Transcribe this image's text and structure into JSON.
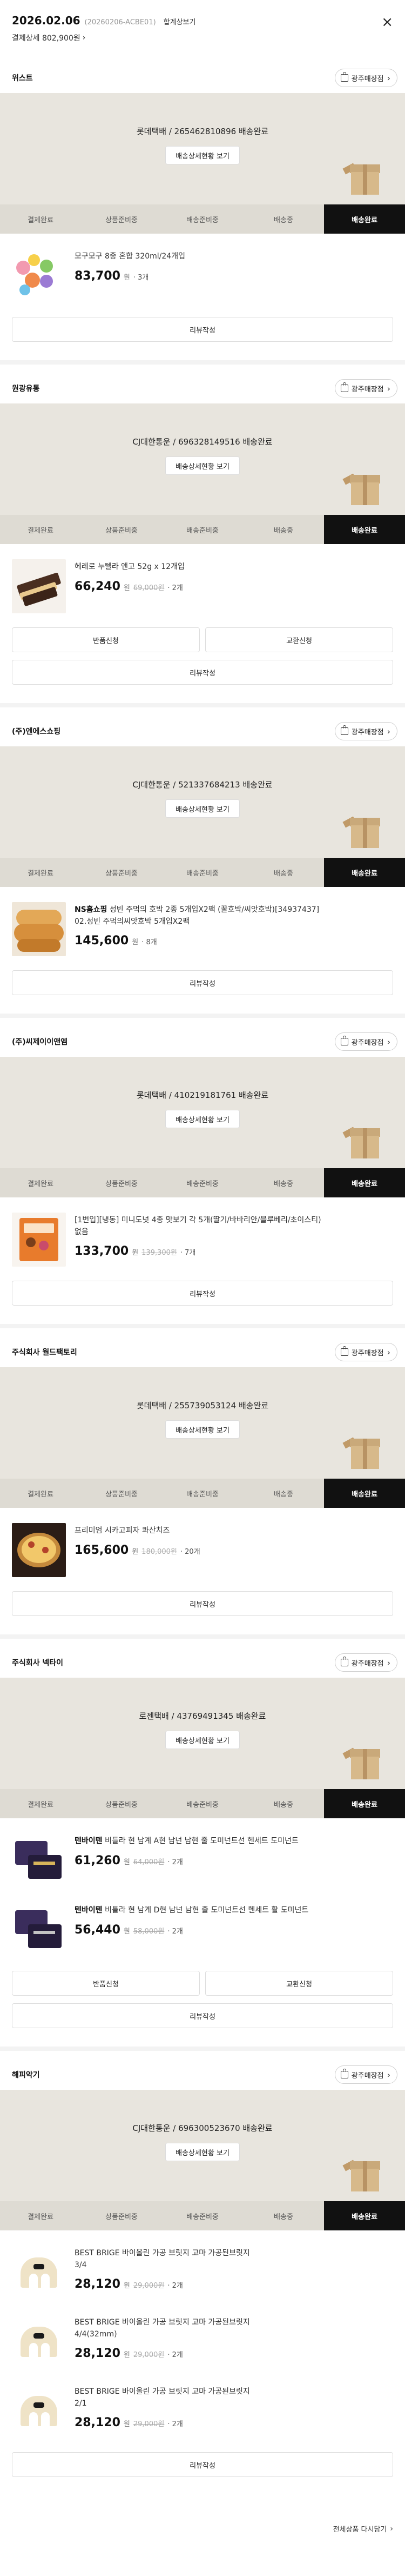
{
  "order": {
    "date": "2026.02.06",
    "order_no": "(20260206-ACBE01)",
    "receipt_label": "합계상보기",
    "amount_label": "결제상세 802,900원",
    "amount_chevron": "›",
    "close_icon": "×"
  },
  "common": {
    "store_link": "광주매장점",
    "store_chevron": "›",
    "track_button": "배송상세현황 보기",
    "steps": [
      "결제완료",
      "상품준비중",
      "배송준비중",
      "배송중",
      "배송완료"
    ],
    "review": "리뷰작성",
    "return": "반품신청",
    "exchange": "교환신청"
  },
  "sellers": [
    {
      "name": "위스트",
      "tracking": "롯데택배 / 265462810896 배송완료",
      "products": [
        {
          "name": "모구모구 8종 혼합 320ml/24개입",
          "price": "83,700",
          "orig": "",
          "qty": "3개"
        }
      ]
    },
    {
      "name": "원광유통",
      "tracking": "CJ대한통운 / 696328149516 배송완료",
      "products": [
        {
          "name": "헤레로 누텔라 앤고 52g x 12개입",
          "price": "66,240",
          "orig": "69,000원",
          "qty": "2개"
        }
      ]
    },
    {
      "name": "(주)엔에스쇼핑",
      "tracking": "CJ대한통운 / 521337684213 배송완료",
      "products": [
        {
          "brand": "NS홈쇼핑",
          "name": "성빈 주먹의 호박 2종 5개입X2팩 (꿀호박/씨앗호박)[34937437]",
          "option": "02.성빈 주먹의씨앗호박 5개입X2팩",
          "price": "145,600",
          "orig": "",
          "qty": "8개"
        }
      ]
    },
    {
      "name": "(주)씨제이이앤엠",
      "tracking": "롯데택배 / 410219181761 배송완료",
      "products": [
        {
          "name": "[1번입][냉동] 미니도넛 4종 맛보기 각 5개(딸기/바바리안/블루베리/초이스티)",
          "option": "없음",
          "price": "133,700",
          "orig": "139,300원",
          "qty": "7개"
        }
      ]
    },
    {
      "name": "주식회사 월드팩토리",
      "tracking": "롯데택배 / 255739053124 배송완료",
      "products": [
        {
          "name": "프리미엄 시카고피자 콰산치즈",
          "price": "165,600",
          "orig": "180,000원",
          "qty": "20개"
        }
      ]
    },
    {
      "name": "주식회사 넥타이",
      "tracking": "로젠택배 / 43769491345 배송완료",
      "products": [
        {
          "brand": "텐바이텐",
          "name": "비틀라 현 남계 A현 남넌 남현 줄 도미넌트선 헨세트 도미넌트",
          "price": "61,260",
          "orig": "64,000원",
          "qty": "2개"
        },
        {
          "brand": "텐바이텐",
          "name": "비틀라 현 남계 D현 남넌 남현 줄 도미넌트선 헨세트 활 도미넌트",
          "price": "56,440",
          "orig": "58,000원",
          "qty": "2개"
        }
      ]
    },
    {
      "name": "해피악기",
      "tracking": "CJ대한통운 / 696300523670 배송완료",
      "products": [
        {
          "name": "BEST BRIGE 바이올린 가공 브릿지 고마 가공된브릿지",
          "option": "3/4",
          "price": "28,120",
          "orig": "29,000원",
          "qty": "2개"
        },
        {
          "name": "BEST BRIGE 바이올린 가공 브릿지 고마 가공된브릿지",
          "option": "4/4(32mm)",
          "price": "28,120",
          "orig": "29,000원",
          "qty": "2개"
        },
        {
          "name": "BEST BRIGE 바이올린 가공 브릿지 고마 가공된브릿지",
          "option": "2/1",
          "price": "28,120",
          "orig": "29,000원",
          "qty": "2개"
        }
      ]
    }
  ],
  "footer": {
    "reorder": "전체상품 다시담기",
    "reorder_chevron": "›"
  },
  "colors": {
    "active_step": "#111111",
    "delivery_bg": "#e8e5de",
    "box": "#d7b98a"
  }
}
